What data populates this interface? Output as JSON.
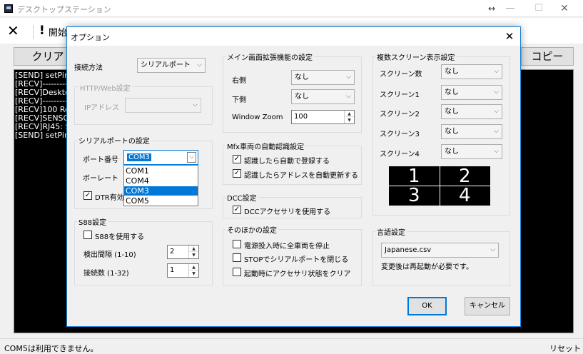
{
  "window": {
    "title": "デスクトップステーション"
  },
  "toolbar": {
    "close_glyph": "✕",
    "start_glyph": "!",
    "start_label": "開始"
  },
  "main": {
    "clear_label": "クリア",
    "copy_label": "コピー",
    "log_lines": [
      "[SEND] setPin",
      "[RECV]-----------",
      "[RECV]Deskto",
      "[RECV]-----------",
      "[RECV]100 Re",
      "[RECV]SENSO",
      "[RECV]RJ45: S",
      "[SEND] setPin"
    ]
  },
  "status": {
    "message": "COM5は利用できません。",
    "reset_label": "リセット"
  },
  "dialog": {
    "title": "オプション",
    "close_glyph": "✕",
    "connection": {
      "label": "接続方法",
      "value": "シリアルポート"
    },
    "http": {
      "group_title": "HTTP/Web設定",
      "ip_label": "IPアドレス",
      "ip_value": ""
    },
    "serial": {
      "group_title": "シリアルポートの設定",
      "port_label": "ポート番号",
      "port_value": "COM3",
      "baud_label": "ボーレート",
      "dtr_label": "DTR有効",
      "options": [
        "COM1",
        "COM4",
        "COM3",
        "COM5"
      ],
      "selected_option": "COM3"
    },
    "s88": {
      "group_title": "S88設定",
      "enable_label": "S88を使用する",
      "interval_label": "検出間隔 (1-10)",
      "interval_value": "2",
      "count_label": "接続数 (1-32)",
      "count_value": "1"
    },
    "zoom": {
      "group_title": "メイン画面拡張機能の設定",
      "right_label": "右側",
      "right_value": "なし",
      "bottom_label": "下側",
      "bottom_value": "なし",
      "window_zoom_label": "Window Zoom",
      "window_zoom_value": "100"
    },
    "mfx": {
      "group_title": "Mfx車両の自動認識設定",
      "auto_register_label": "認識したら自動で登録する",
      "auto_update_label": "認識したらアドレスを自動更新する"
    },
    "dcc": {
      "group_title": "DCC設定",
      "accessory_label": "DCCアクセサリを使用する"
    },
    "other": {
      "group_title": "そのほかの設定",
      "stop_all_label": "電源投入時に全車両を停止",
      "close_serial_label": "STOPでシリアルポートを閉じる",
      "clear_accessory_label": "起動時にアクセサリ状態をクリア"
    },
    "multiscreen": {
      "group_title": "複数スクリーン表示設定",
      "count_label": "スクリーン数",
      "count_value": "なし",
      "screen1_label": "スクリーン1",
      "screen1_value": "なし",
      "screen2_label": "スクリーン2",
      "screen2_value": "なし",
      "screen3_label": "スクリーン3",
      "screen3_value": "なし",
      "screen4_label": "スクリーン4",
      "screen4_value": "なし",
      "diagram": [
        "1",
        "2",
        "3",
        "4"
      ]
    },
    "language": {
      "group_title": "言語設定",
      "value": "Japanese.csv",
      "note": "変更後は再起動が必要です。"
    },
    "ok_label": "OK",
    "cancel_label": "キャンセル"
  },
  "colors": {
    "accent": "#0078d7",
    "dialog_border": "#1883d7",
    "log_bg": "#000000"
  }
}
